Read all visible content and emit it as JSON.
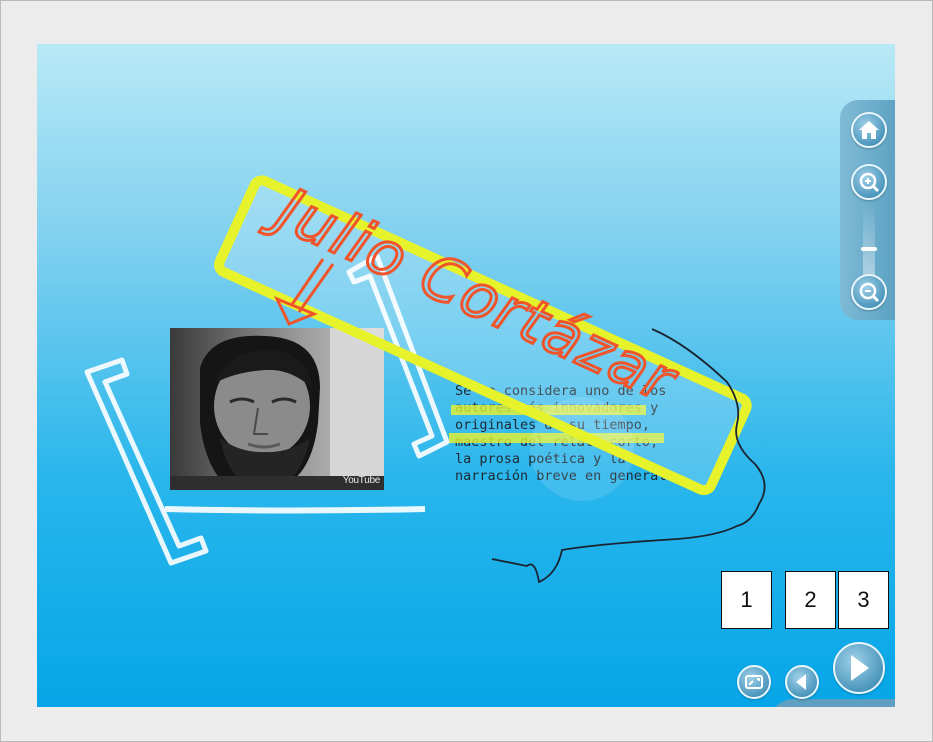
{
  "title_handwritten": "Julio Cortázar",
  "bio_text": "Se le considera uno de los\nautores más innovadores y\noriginales de su tiempo,\nmaestro del relato corto,\nla prosa poética y la\nnarración breve en general.",
  "video": {
    "watermark": "YouTube"
  },
  "markers": [
    "1",
    "2",
    "3"
  ],
  "zoom_controls": {
    "icons": [
      "home-icon",
      "zoom-in-icon",
      "zoom-out-icon"
    ]
  },
  "nav_controls": {
    "icons": [
      "fullscreen-icon",
      "prev-arrow-icon",
      "next-arrow-icon"
    ]
  },
  "colors": {
    "annotation_yellow": "#e7f32a",
    "handwriting_red": "#f0542a",
    "ink_dark": "#1a2430",
    "sky_light": "#b8e9f6",
    "sky_dark": "#05a6e8"
  }
}
